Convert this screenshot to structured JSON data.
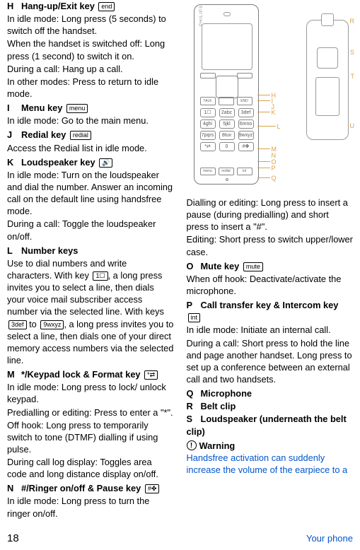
{
  "col1": {
    "h": {
      "letter": "H",
      "title": "Hang-up/Exit key",
      "box": "end"
    },
    "h_lines": [
      "In idle mode: Long press (5 seconds) to switch off the handset.",
      "When the handset is switched off: Long press (1 second) to switch it on.",
      "During a call: Hang up a call.",
      "In other modes: Press to return to idle mode."
    ],
    "i": {
      "letter": "I",
      "title": "Menu key",
      "box": "menu"
    },
    "i_lines": [
      "In idle mode: Go to the main menu."
    ],
    "j": {
      "letter": "J",
      "title": "Redial key",
      "box": "redial"
    },
    "j_lines": [
      "Access the Redial list in idle mode."
    ],
    "k": {
      "letter": "K",
      "title": "Loudspeaker key",
      "box": "🔊"
    },
    "k_lines": [
      "In idle mode: Turn on the loudspeaker and dial the number. Answer an incoming call on the default line using handsfree mode.",
      "During a call: Toggle the loudspeaker on/off."
    ],
    "l": {
      "letter": "L",
      "title": "Number keys"
    },
    "l_pre": "Use to dial numbers and write characters. With key ",
    "l_box1": "1☐",
    "l_mid1": ", a long press invites you to select a line,  then dials your voice mail subscriber access number via the selected line. With keys ",
    "l_box2": "3def",
    "l_to": " to ",
    "l_box3": "9wxyz",
    "l_post": ", a long press invites you to select a line, then dials one of your direct memory access numbers via the selected line.",
    "m": {
      "letter": "M",
      "title": "*/Keypad lock & Format key",
      "box": "*⇄"
    },
    "m_lines": [
      "In idle mode: Long press to lock/ unlock keypad.",
      "Predialling or editing: Press to enter a \"*\".",
      "Off hook: Long press to temporarily switch to tone (DTMF) dialling if using pulse.",
      "During call log display: Toggles area code and long distance display on/off."
    ],
    "n": {
      "letter": "N",
      "title": "#/Ringer on/off & Pause key",
      "box": "#✤"
    },
    "n_lines": [
      "In idle mode: Long press to turn the ringer on/off."
    ]
  },
  "col2": {
    "diagram_callouts_left": [
      "H",
      "I",
      "J",
      "K",
      "L",
      "M",
      "N",
      "O",
      "P",
      "Q"
    ],
    "diagram_callouts_right": [
      "R",
      "S",
      "T",
      "U"
    ],
    "brand": "PHILIPS",
    "mid_btns": [
      "TALK",
      "",
      "END"
    ],
    "numkeys": [
      "1☐",
      "2abc",
      "3def",
      "4ghi",
      "5jkl",
      "6mno",
      "7pqrs",
      "8tuv",
      "9wxyz",
      "*⇄",
      "0",
      "#✤"
    ],
    "last_btns": [
      "menu",
      "redial",
      "int"
    ],
    "n_cont": [
      "Dialling or editing: Long press to insert a pause (during predialling) and short press to insert a \"#\".",
      "Editing: Short press to switch upper/lower case."
    ],
    "o": {
      "letter": "O",
      "title": "Mute key",
      "box": "mute"
    },
    "o_lines": [
      "When off hook: Deactivate/activate the microphone."
    ],
    "p": {
      "letter": "P",
      "title": "Call transfer key & Intercom key",
      "box": "int"
    },
    "p_lines": [
      "In idle mode: Initiate an internal call.",
      "During a call: Short press to hold the line and page another handset. Long press to set up a conference between an external call and two handsets."
    ],
    "q": {
      "letter": "Q",
      "title": "Microphone"
    },
    "r": {
      "letter": "R",
      "title": "Belt clip"
    },
    "s": {
      "letter": "S",
      "title": "Loudspeaker (underneath the belt clip)"
    },
    "warn_title": "Warning",
    "warn_text": "Handsfree activation can suddenly increase the volume of the earpiece to a"
  },
  "footer": {
    "page": "18",
    "label": "Your phone"
  }
}
